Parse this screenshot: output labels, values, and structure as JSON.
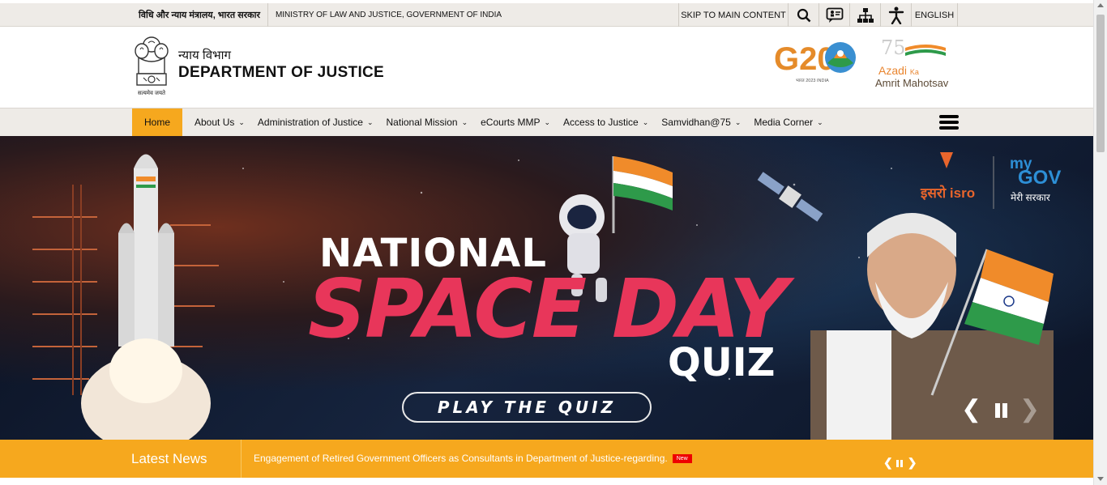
{
  "topbar": {
    "hindi_ministry": "विधि और न्याय मंत्रालय, भारत सरकार",
    "english_ministry": "MINISTRY OF LAW AND JUSTICE, GOVERNMENT OF INDIA",
    "skip": "SKIP TO MAIN CONTENT",
    "icons": [
      "search-icon",
      "feedback-icon",
      "sitemap-icon",
      "accessibility-icon"
    ],
    "language": "ENGLISH"
  },
  "header": {
    "emblem_caption": "सत्यमेव जयते",
    "dept_hindi": "न्याय विभाग",
    "dept_english": "DEPARTMENT OF JUSTICE",
    "g20_text": "G20",
    "g20_sub": "भारत 2023 INDIA",
    "azadi_75": "75",
    "azadi_line1": "Azadi",
    "azadi_ka": "Ka",
    "azadi_line2": "Amrit Mahotsav"
  },
  "nav": {
    "home": "Home",
    "items": [
      {
        "label": "About Us"
      },
      {
        "label": "Administration of Justice"
      },
      {
        "label": "National Mission"
      },
      {
        "label": "eCourts MMP"
      },
      {
        "label": "Access to Justice"
      },
      {
        "label": "Samvidhan@75"
      },
      {
        "label": "Media Corner"
      }
    ]
  },
  "banner": {
    "line1": "NATIONAL",
    "line2": "SPACE DAY",
    "line3": "QUIZ",
    "button": "PLAY THE QUIZ",
    "isro": "इसरो isro",
    "mygov_my": "my",
    "mygov_gov": "GOV",
    "mygov_sub": "मेरी सरकार"
  },
  "news": {
    "label": "Latest News",
    "item": "Engagement of Retired Government Officers as Consultants in Department of Justice-regarding.",
    "badge": "New"
  },
  "colors": {
    "accent": "#f6a81e",
    "topbar_bg": "#eeebe7",
    "space_pink": "#e8365a"
  }
}
